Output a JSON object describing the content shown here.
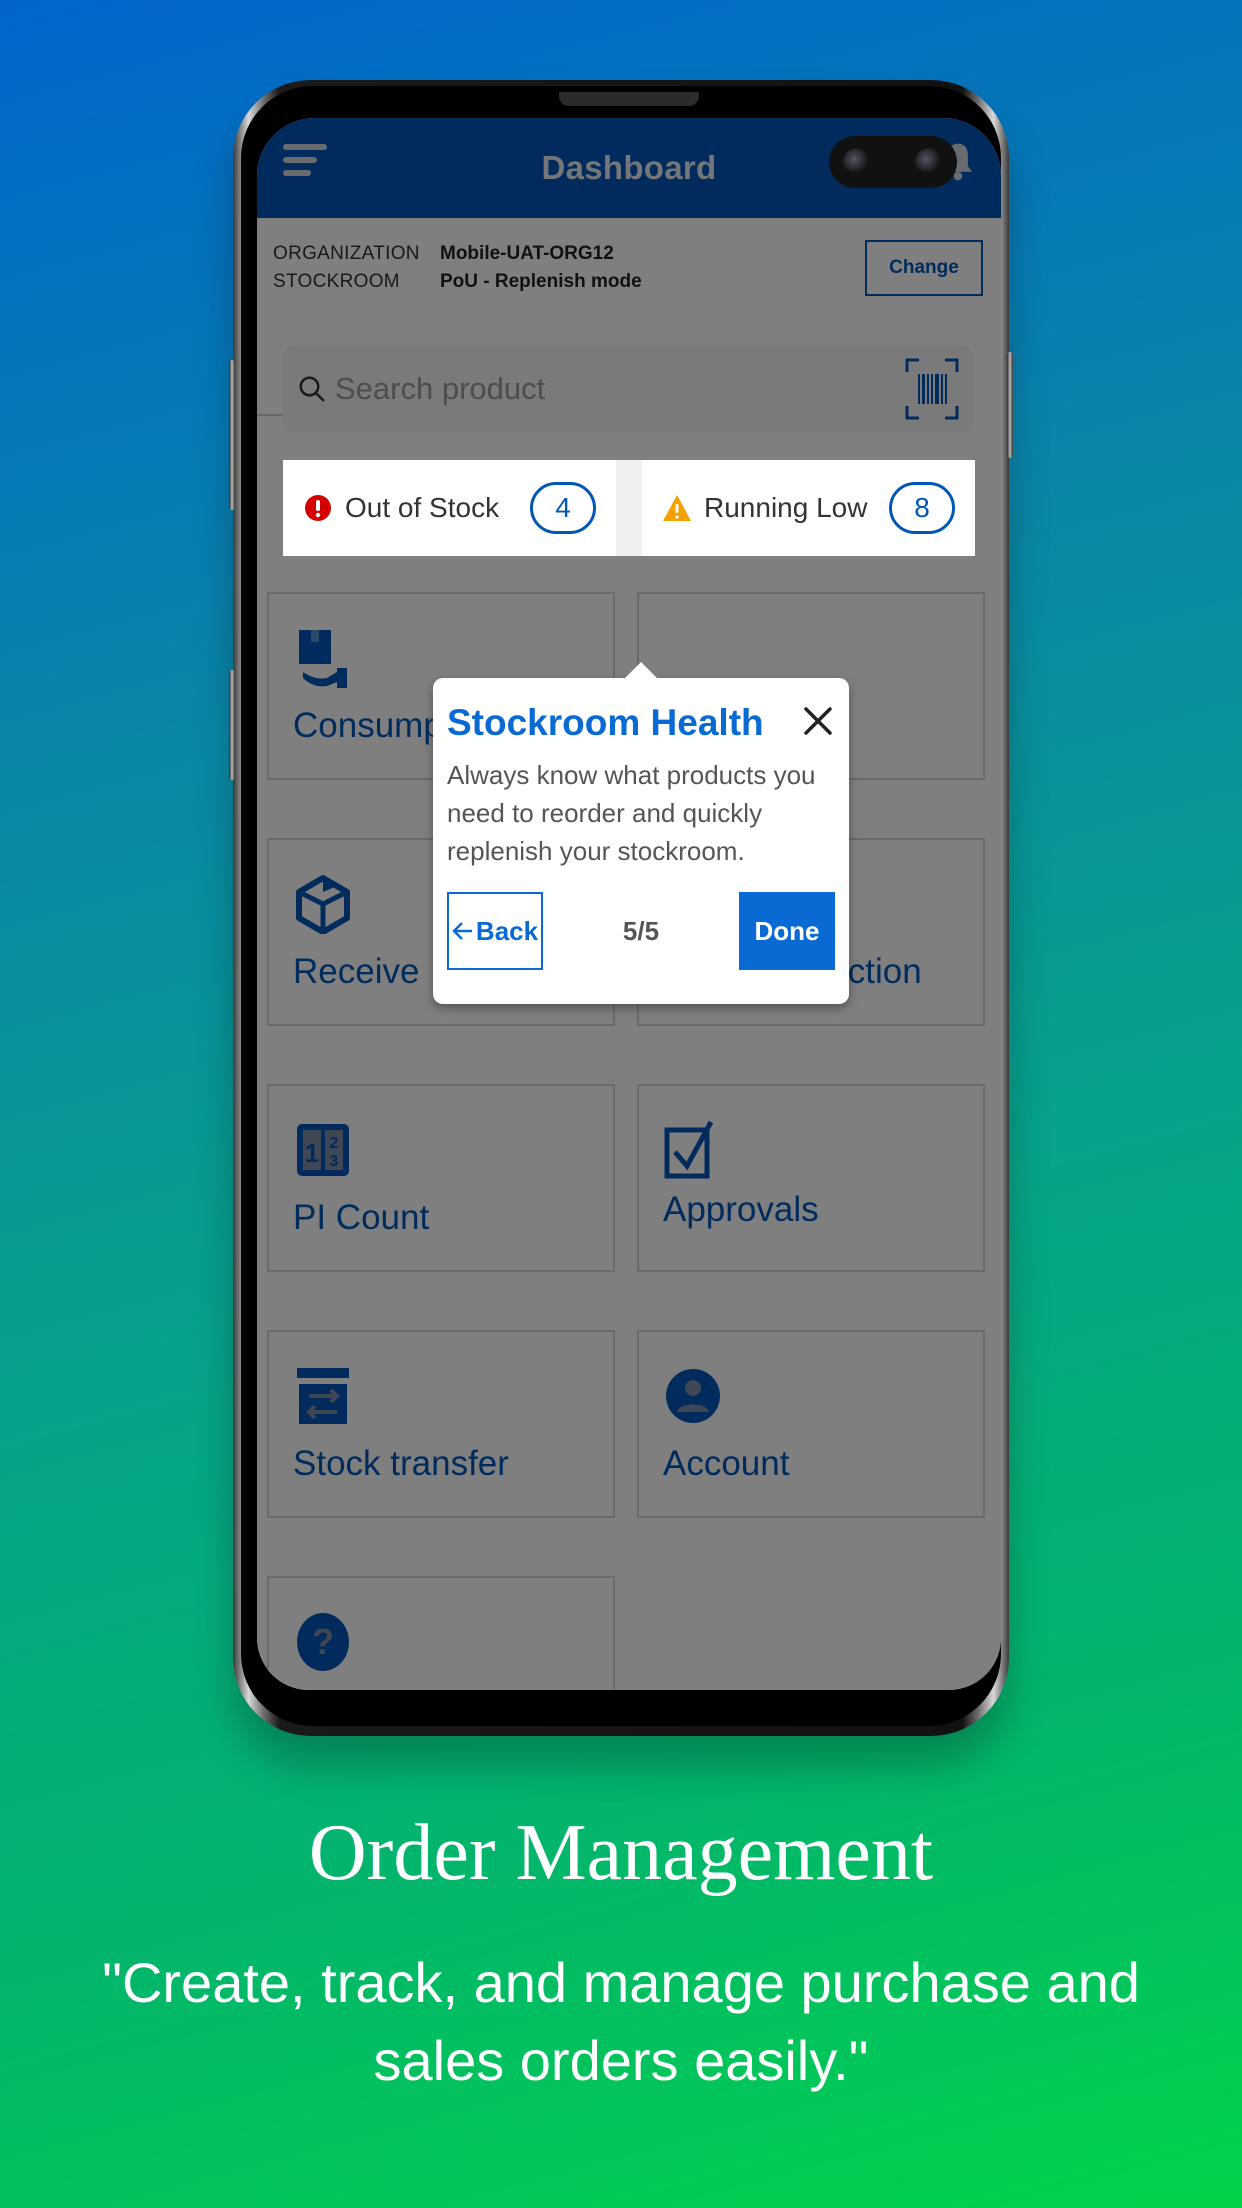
{
  "app": {
    "header_title": "Dashboard",
    "menu_icon": "hamburger-menu-icon",
    "notification_icon": "bell-icon"
  },
  "organization": {
    "org_label": "ORGANIZATION",
    "org_value": "Mobile-UAT-ORG12",
    "stockroom_label": "STOCKROOM",
    "stockroom_value": "PoU - Replenish mode",
    "change_button": "Change"
  },
  "search": {
    "placeholder": "Search product",
    "value": ""
  },
  "status": [
    {
      "label": "Out of Stock",
      "count": "4",
      "icon": "error-circle-icon",
      "color": "#d40000"
    },
    {
      "label": "Running Low",
      "count": "8",
      "icon": "warning-triangle-icon",
      "color": "#f5a000"
    }
  ],
  "tiles": [
    {
      "label": "Consumption",
      "visible_label": "Consum",
      "icon": "consume-hand-box-icon"
    },
    {
      "label": "",
      "icon": ""
    },
    {
      "label": "Receive",
      "icon": "open-box-icon"
    },
    {
      "label": "Stock Correction",
      "icon": "edit-box-icon"
    },
    {
      "label": "PI Count",
      "icon": "count-numbers-icon"
    },
    {
      "label": "Approvals",
      "icon": "checkbox-icon"
    },
    {
      "label": "Stock transfer",
      "icon": "transfer-box-icon"
    },
    {
      "label": "Account",
      "icon": "user-circle-icon"
    },
    {
      "label": "",
      "icon": "help-circle-icon"
    }
  ],
  "popover": {
    "title": "Stockroom Health",
    "body": "Always know what products you need to reorder and quickly replenish your stockroom.",
    "back_label": "Back",
    "step": "5/5",
    "done_label": "Done"
  },
  "promo": {
    "title": "Order Management",
    "subtitle": "\"Create, track, and manage purchase and sales orders easily.\""
  },
  "colors": {
    "brand_blue": "#0057b8",
    "popover_blue": "#0a6ad4",
    "error_red": "#d40000",
    "warning_orange": "#f5a000",
    "bg_gradient_start": "#0066cc",
    "bg_gradient_end": "#00d34a"
  }
}
